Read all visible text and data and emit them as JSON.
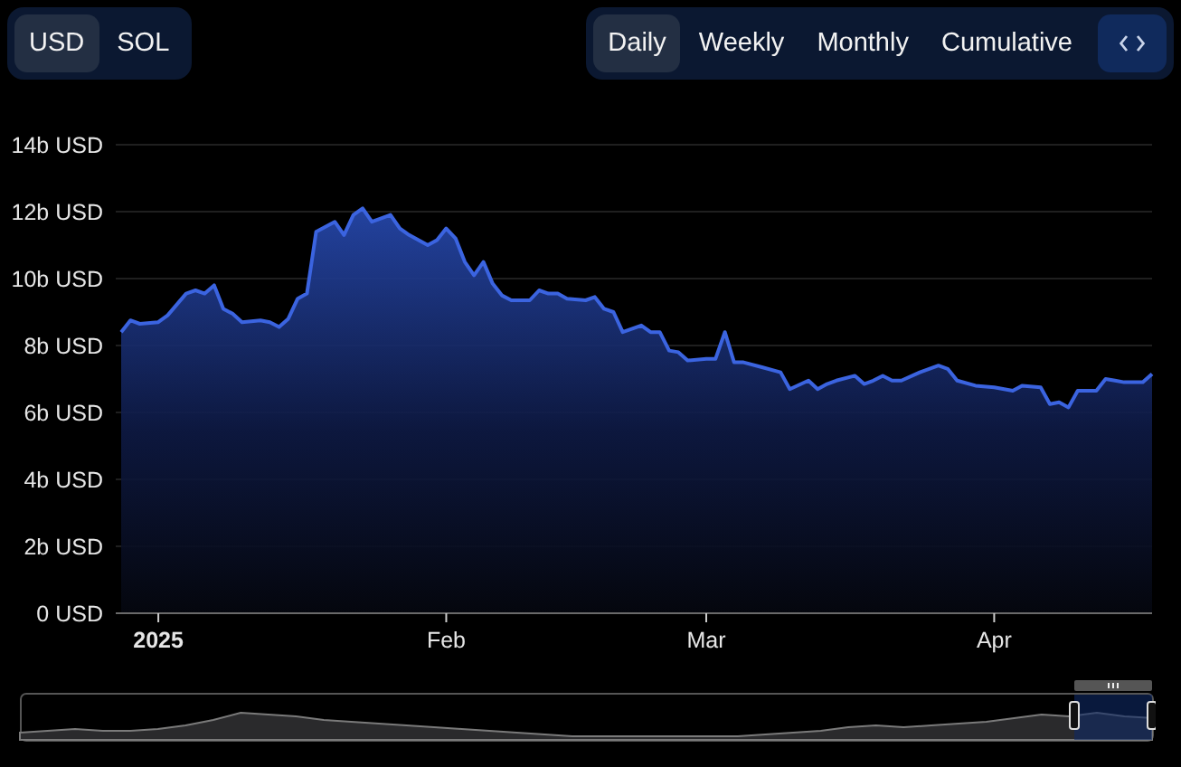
{
  "currency_tabs": [
    {
      "label": "USD",
      "selected": true
    },
    {
      "label": "SOL",
      "selected": false
    }
  ],
  "period_tabs": [
    {
      "label": "Daily",
      "selected": true
    },
    {
      "label": "Weekly",
      "selected": false
    },
    {
      "label": "Monthly",
      "selected": false
    },
    {
      "label": "Cumulative",
      "selected": false
    }
  ],
  "chart": {
    "chart_data": {
      "type": "area",
      "x": [
        "2024-12-28",
        "2024-12-29",
        "2024-12-30",
        "2025-01-01",
        "2025-01-02",
        "2025-01-04",
        "2025-01-05",
        "2025-01-06",
        "2025-01-07",
        "2025-01-08",
        "2025-01-09",
        "2025-01-10",
        "2025-01-12",
        "2025-01-13",
        "2025-01-14",
        "2025-01-15",
        "2025-01-16",
        "2025-01-17",
        "2025-01-18",
        "2025-01-20",
        "2025-01-21",
        "2025-01-22",
        "2025-01-23",
        "2025-01-24",
        "2025-01-25",
        "2025-01-26",
        "2025-01-27",
        "2025-01-28",
        "2025-01-30",
        "2025-01-31",
        "2025-02-01",
        "2025-02-02",
        "2025-02-03",
        "2025-02-04",
        "2025-02-05",
        "2025-02-06",
        "2025-02-07",
        "2025-02-08",
        "2025-02-10",
        "2025-02-11",
        "2025-02-12",
        "2025-02-13",
        "2025-02-14",
        "2025-02-16",
        "2025-02-17",
        "2025-02-18",
        "2025-02-19",
        "2025-02-20",
        "2025-02-22",
        "2025-02-23",
        "2025-02-24",
        "2025-02-25",
        "2025-02-26",
        "2025-02-27",
        "2025-03-01",
        "2025-03-02",
        "2025-03-03",
        "2025-03-04",
        "2025-03-05",
        "2025-03-07",
        "2025-03-09",
        "2025-03-10",
        "2025-03-12",
        "2025-03-13",
        "2025-03-14",
        "2025-03-15",
        "2025-03-17",
        "2025-03-18",
        "2025-03-19",
        "2025-03-20",
        "2025-03-21",
        "2025-03-22",
        "2025-03-24",
        "2025-03-26",
        "2025-03-27",
        "2025-03-28",
        "2025-03-30",
        "2025-04-01",
        "2025-04-03",
        "2025-04-04",
        "2025-04-06",
        "2025-04-07",
        "2025-04-08",
        "2025-04-09",
        "2025-04-10",
        "2025-04-12",
        "2025-04-13",
        "2025-04-14",
        "2025-04-15",
        "2025-04-17",
        "2025-04-18"
      ],
      "grid": true,
      "series": [
        {
          "color": "#3b64e0",
          "values": [
            8.4,
            8.75,
            8.65,
            8.7,
            8.9,
            9.55,
            9.65,
            9.55,
            9.8,
            9.1,
            8.95,
            8.7,
            8.75,
            8.7,
            8.55,
            8.8,
            9.4,
            9.55,
            11.4,
            11.7,
            11.3,
            11.9,
            12.1,
            11.7,
            11.8,
            11.9,
            11.5,
            11.3,
            11.0,
            11.15,
            11.5,
            11.2,
            10.5,
            10.1,
            10.5,
            9.85,
            9.5,
            9.35,
            9.35,
            9.65,
            9.55,
            9.55,
            9.4,
            9.35,
            9.45,
            9.1,
            9.0,
            8.4,
            8.6,
            8.4,
            8.4,
            7.85,
            7.8,
            7.55,
            7.6,
            7.6,
            8.4,
            7.5,
            7.5,
            7.35,
            7.2,
            6.7,
            6.95,
            6.7,
            6.85,
            6.95,
            7.1,
            6.85,
            6.95,
            7.1,
            6.95,
            6.95,
            7.2,
            7.4,
            7.3,
            6.95,
            6.8,
            6.75,
            6.65,
            6.8,
            6.75,
            6.25,
            6.3,
            6.15,
            6.65,
            6.65,
            7.0,
            6.95,
            6.9,
            6.9,
            7.15
          ]
        }
      ],
      "xlim": [
        "2024-12-28",
        "2025-04-18"
      ],
      "ylim": [
        0,
        14
      ],
      "xticks": [
        {
          "value": "2025-01-01",
          "label": "2025"
        },
        {
          "value": "2025-02-01",
          "label": "Feb"
        },
        {
          "value": "2025-03-01",
          "label": "Mar"
        },
        {
          "value": "2025-04-01",
          "label": "Apr"
        }
      ],
      "yticks": [
        {
          "value": 0,
          "label": "0 USD"
        },
        {
          "value": 2,
          "label": "2b USD"
        },
        {
          "value": 4,
          "label": "4b USD"
        },
        {
          "value": 6,
          "label": "6b USD"
        },
        {
          "value": 8,
          "label": "8b USD"
        },
        {
          "value": 10,
          "label": "10b USD"
        },
        {
          "value": 12,
          "label": "12b USD"
        },
        {
          "value": 14,
          "label": "14b USD"
        }
      ]
    }
  }
}
